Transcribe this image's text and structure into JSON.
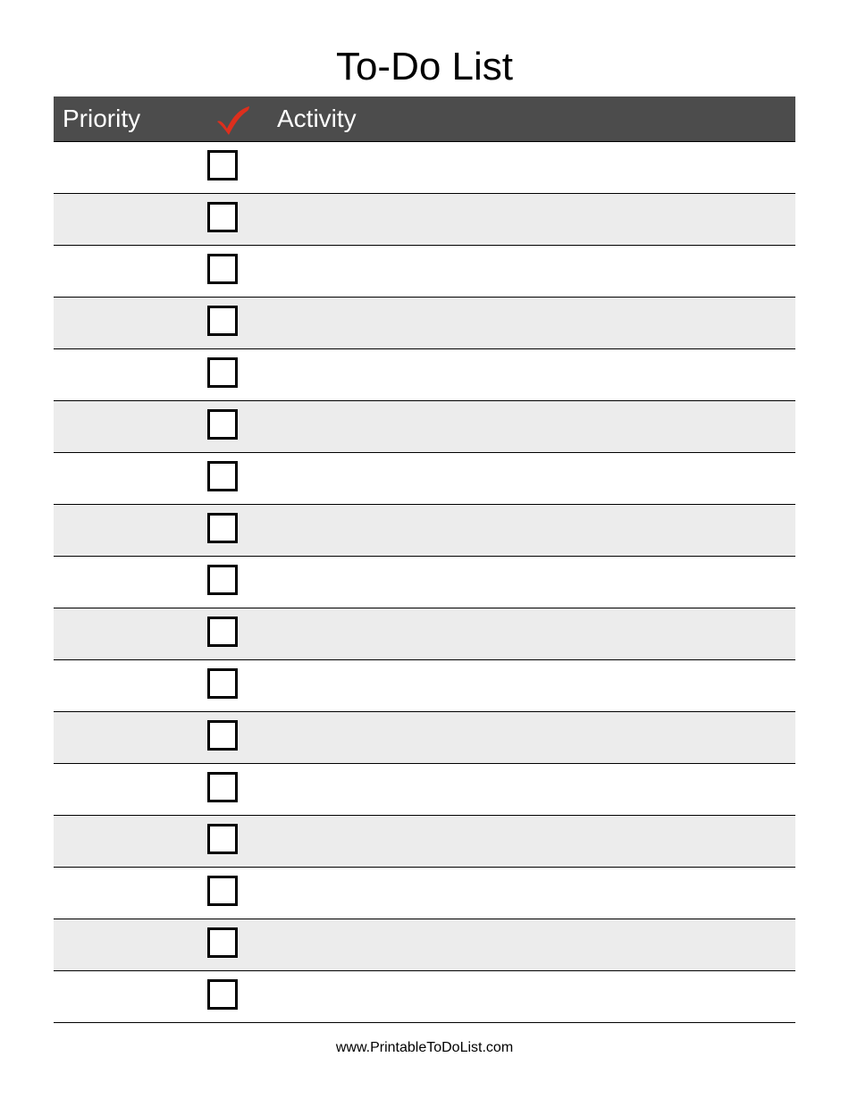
{
  "title": "To-Do List",
  "columns": {
    "priority": "Priority",
    "activity": "Activity"
  },
  "rows": [
    {
      "priority": "",
      "checked": false,
      "activity": ""
    },
    {
      "priority": "",
      "checked": false,
      "activity": ""
    },
    {
      "priority": "",
      "checked": false,
      "activity": ""
    },
    {
      "priority": "",
      "checked": false,
      "activity": ""
    },
    {
      "priority": "",
      "checked": false,
      "activity": ""
    },
    {
      "priority": "",
      "checked": false,
      "activity": ""
    },
    {
      "priority": "",
      "checked": false,
      "activity": ""
    },
    {
      "priority": "",
      "checked": false,
      "activity": ""
    },
    {
      "priority": "",
      "checked": false,
      "activity": ""
    },
    {
      "priority": "",
      "checked": false,
      "activity": ""
    },
    {
      "priority": "",
      "checked": false,
      "activity": ""
    },
    {
      "priority": "",
      "checked": false,
      "activity": ""
    },
    {
      "priority": "",
      "checked": false,
      "activity": ""
    },
    {
      "priority": "",
      "checked": false,
      "activity": ""
    },
    {
      "priority": "",
      "checked": false,
      "activity": ""
    },
    {
      "priority": "",
      "checked": false,
      "activity": ""
    },
    {
      "priority": "",
      "checked": false,
      "activity": ""
    }
  ],
  "footer": "www.PrintableToDoList.com",
  "colors": {
    "header_bg": "#4c4c4c",
    "stripe": "#ececec",
    "checkmark": "#dd2f1d"
  }
}
